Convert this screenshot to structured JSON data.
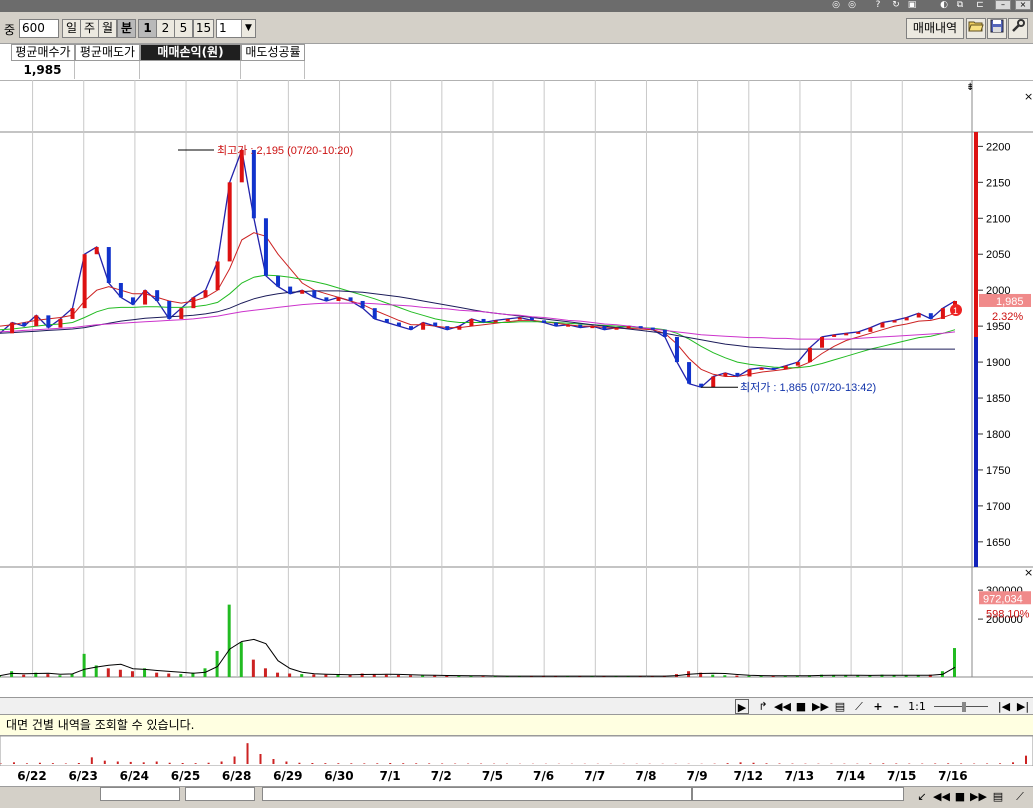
{
  "toolbar": {
    "category_label": "중",
    "count_value": "600",
    "periods": [
      "일",
      "주",
      "월",
      "분"
    ],
    "intervals": [
      "1",
      "2",
      "5",
      "15"
    ],
    "interval_select_value": "1",
    "trade_history_button": "매매내역",
    "open_icon": "folder-open-icon",
    "save_icon": "save-icon",
    "settings_icon": "wrench-icon"
  },
  "summary": {
    "headers": [
      "평균매수가",
      "평균매도가",
      "매매손익(원)",
      "매도성공률"
    ],
    "values": [
      "1,985",
      "",
      "",
      ""
    ]
  },
  "chart_data": {
    "type": "line",
    "price": {
      "yticks": [
        2200,
        2150,
        2100,
        2050,
        2000,
        1950,
        1900,
        1850,
        1800,
        1750,
        1700,
        1650
      ],
      "ylim": [
        1615,
        2220
      ],
      "high_annotation": "최고가 : 2,195 (07/20-10:20)",
      "low_annotation": "최저가 : 1,865 (07/20-13:42)",
      "current_price": "1,985",
      "current_change": "2.32%",
      "marker_label": "1",
      "series": [
        {
          "name": "price",
          "color": "#2222aa",
          "values": [
            1940,
            1955,
            1950,
            1965,
            1948,
            1960,
            1975,
            2050,
            2060,
            2010,
            1990,
            1980,
            2000,
            1985,
            1960,
            1975,
            1990,
            2000,
            2040,
            2150,
            2195,
            2100,
            2020,
            2005,
            1995,
            2000,
            1990,
            1985,
            1990,
            1985,
            1975,
            1960,
            1955,
            1950,
            1945,
            1955,
            1950,
            1945,
            1950,
            1960,
            1955,
            1958,
            1960,
            1962,
            1958,
            1955,
            1950,
            1952,
            1948,
            1950,
            1945,
            1948,
            1950,
            1948,
            1945,
            1935,
            1900,
            1870,
            1865,
            1880,
            1885,
            1880,
            1890,
            1892,
            1890,
            1895,
            1900,
            1920,
            1935,
            1938,
            1940,
            1942,
            1948,
            1955,
            1958,
            1962,
            1968,
            1960,
            1975,
            1985
          ]
        },
        {
          "name": "ma-red",
          "color": "#cc2222",
          "values": [
            1950,
            1952,
            1955,
            1958,
            1960,
            1962,
            1965,
            1985,
            2000,
            2005,
            2000,
            1995,
            1995,
            1990,
            1985,
            1982,
            1985,
            1990,
            2000,
            2030,
            2070,
            2080,
            2075,
            2050,
            2030,
            2010,
            2000,
            1995,
            1990,
            1985,
            1980,
            1972,
            1965,
            1958,
            1952,
            1952,
            1950,
            1948,
            1948,
            1950,
            1952,
            1954,
            1956,
            1958,
            1958,
            1956,
            1954,
            1952,
            1950,
            1950,
            1948,
            1947,
            1947,
            1946,
            1945,
            1940,
            1925,
            1905,
            1890,
            1883,
            1880,
            1880,
            1883,
            1886,
            1888,
            1890,
            1893,
            1900,
            1912,
            1922,
            1930,
            1935,
            1940,
            1945,
            1950,
            1953,
            1957,
            1958,
            1962,
            1968
          ]
        },
        {
          "name": "ma-green",
          "color": "#22bb22",
          "values": [
            1945,
            1946,
            1948,
            1950,
            1952,
            1953,
            1955,
            1962,
            1970,
            1975,
            1976,
            1976,
            1977,
            1977,
            1976,
            1976,
            1977,
            1979,
            1983,
            1995,
            2010,
            2018,
            2021,
            2020,
            2018,
            2015,
            2012,
            2008,
            2003,
            1998,
            1993,
            1988,
            1982,
            1976,
            1970,
            1965,
            1960,
            1957,
            1955,
            1955,
            1955,
            1955,
            1955,
            1956,
            1956,
            1956,
            1955,
            1954,
            1953,
            1952,
            1951,
            1950,
            1949,
            1948,
            1947,
            1945,
            1940,
            1932,
            1922,
            1913,
            1906,
            1900,
            1897,
            1895,
            1893,
            1892,
            1892,
            1894,
            1898,
            1903,
            1908,
            1913,
            1918,
            1922,
            1926,
            1930,
            1934,
            1936,
            1940,
            1945
          ]
        },
        {
          "name": "ma-navy",
          "color": "#1c1c5a",
          "values": [
            1940,
            1941,
            1942,
            1943,
            1944,
            1945,
            1946,
            1948,
            1951,
            1954,
            1957,
            1959,
            1961,
            1962,
            1963,
            1964,
            1965,
            1967,
            1970,
            1975,
            1982,
            1988,
            1992,
            1995,
            1997,
            1998,
            1999,
            1999,
            1999,
            1998,
            1997,
            1995,
            1993,
            1991,
            1988,
            1985,
            1982,
            1979,
            1976,
            1973,
            1970,
            1968,
            1966,
            1964,
            1962,
            1960,
            1958,
            1956,
            1954,
            1952,
            1950,
            1948,
            1946,
            1944,
            1942,
            1940,
            1937,
            1934,
            1931,
            1928,
            1925,
            1923,
            1921,
            1920,
            1919,
            1918,
            1918,
            1918,
            1918,
            1918,
            1918,
            1918,
            1918,
            1918,
            1918,
            1918,
            1918,
            1918,
            1918,
            1918
          ]
        },
        {
          "name": "ma-magenta",
          "color": "#cc33cc",
          "values": [
            1942,
            1943,
            1944,
            1945,
            1946,
            1947,
            1948,
            1950,
            1952,
            1953,
            1954,
            1955,
            1956,
            1957,
            1958,
            1959,
            1960,
            1962,
            1964,
            1967,
            1970,
            1972,
            1974,
            1976,
            1978,
            1980,
            1981,
            1982,
            1982,
            1982,
            1982,
            1981,
            1980,
            1979,
            1978,
            1976,
            1975,
            1974,
            1972,
            1971,
            1970,
            1968,
            1966,
            1965,
            1963,
            1962,
            1960,
            1958,
            1957,
            1955,
            1953,
            1952,
            1950,
            1948,
            1946,
            1944,
            1942,
            1940,
            1938,
            1937,
            1936,
            1935,
            1934,
            1934,
            1933,
            1933,
            1932,
            1932,
            1932,
            1932,
            1932,
            1933,
            1934,
            1935,
            1936,
            1937,
            1938,
            1939,
            1940,
            1942
          ]
        }
      ]
    },
    "volume": {
      "yticks": [
        300000,
        200000
      ],
      "ylim": [
        0,
        380000
      ],
      "current_volume": "972,034",
      "current_ratio": "598.10%",
      "values": [
        5000,
        20000,
        8000,
        15000,
        10000,
        6000,
        12000,
        80000,
        40000,
        30000,
        25000,
        20000,
        30000,
        15000,
        12000,
        10000,
        15000,
        30000,
        90000,
        250000,
        120000,
        60000,
        30000,
        15000,
        12000,
        10000,
        9000,
        8000,
        7000,
        8000,
        12000,
        9000,
        8000,
        7000,
        6000,
        5000,
        5000,
        5000,
        4000,
        4000,
        3000,
        3000,
        3000,
        3000,
        3000,
        3000,
        3000,
        3000,
        3000,
        3000,
        3000,
        3000,
        3000,
        3000,
        3000,
        4000,
        10000,
        20000,
        15000,
        8000,
        6000,
        5000,
        4000,
        4000,
        4000,
        4000,
        4000,
        6000,
        8000,
        6000,
        5000,
        5000,
        6000,
        8000,
        6000,
        5000,
        6000,
        8000,
        20000,
        100000
      ]
    },
    "dates": [
      "6/22",
      "6/23",
      "6/24",
      "6/25",
      "6/28",
      "6/29",
      "6/30",
      "7/1",
      "7/2",
      "7/5",
      "7/6",
      "7/7",
      "7/8",
      "7/9",
      "7/12",
      "7/13",
      "7/14",
      "7/15",
      "7/16"
    ]
  },
  "bottom": {
    "zoom_label": "1:1",
    "notice": "대면 건별 내역을 조회할 수 있습니다."
  }
}
